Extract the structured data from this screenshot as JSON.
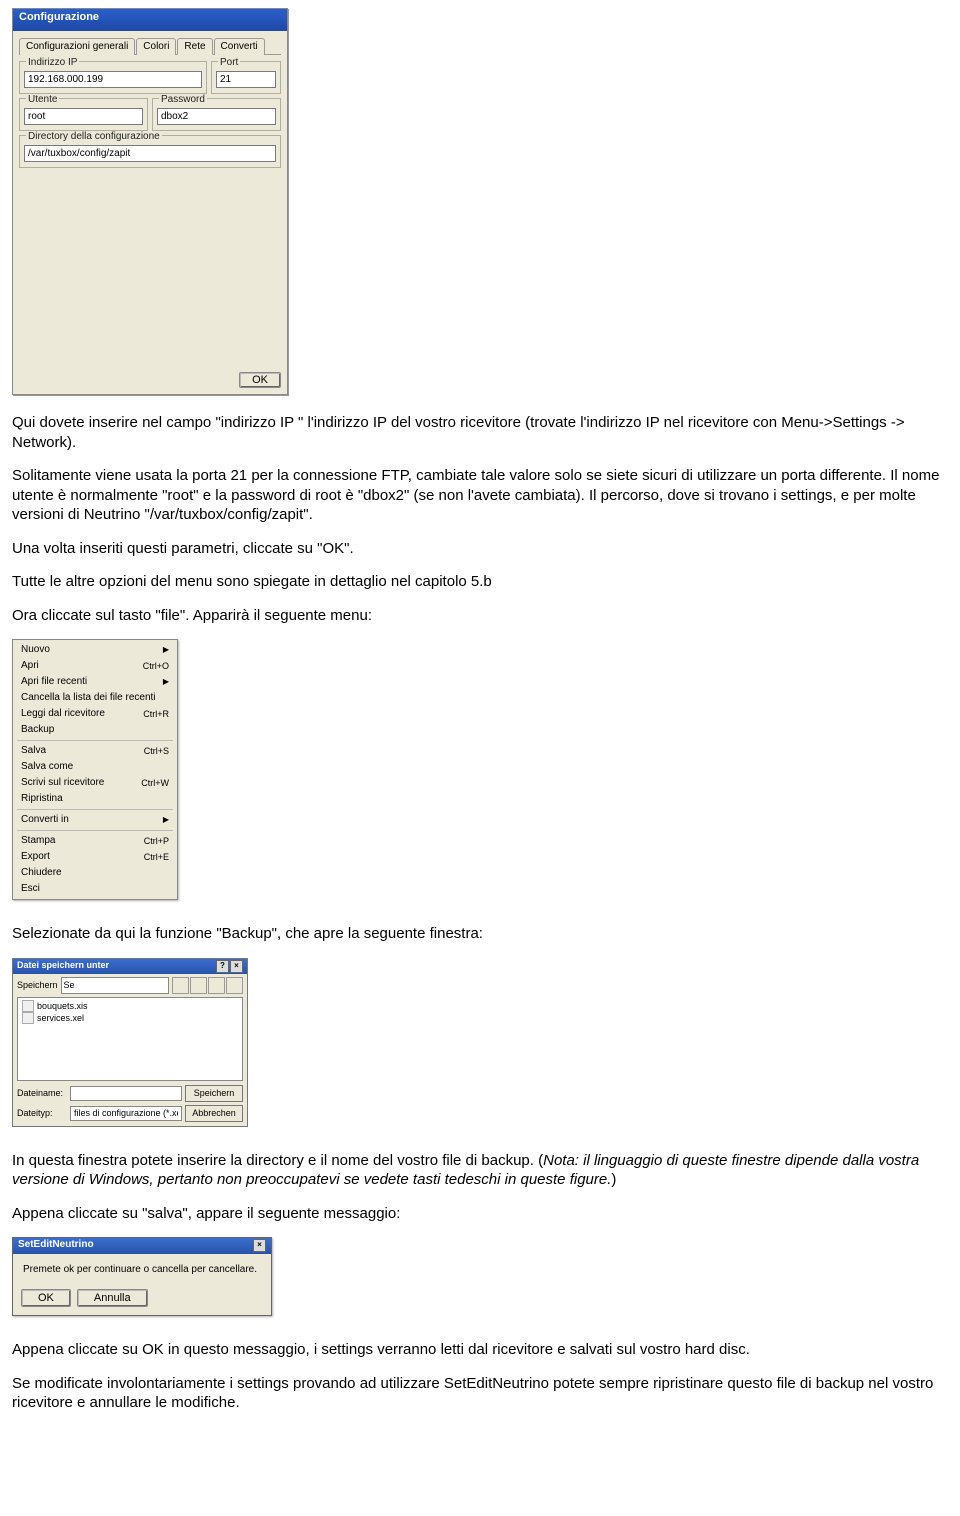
{
  "config_dialog": {
    "title": "Configurazione",
    "tabs": [
      "Configurazioni generali",
      "Colori",
      "Rete",
      "Converti"
    ],
    "active_tab_index": 2,
    "ip_label": "Indirizzo IP",
    "ip_value": "192.168.000.199",
    "port_label": "Port",
    "port_value": "21",
    "user_label": "Utente",
    "user_value": "root",
    "pass_label": "Password",
    "pass_value": "dbox2",
    "dir_label": "Directory della configurazione",
    "dir_value": "/var/tuxbox/config/zapit",
    "ok": "OK"
  },
  "para1": "Qui dovete inserire nel campo \"indirizzo IP \" l'indirizzo IP del vostro ricevitore (trovate l'indirizzo IP nel ricevitore con Menu->Settings -> Network).",
  "para2": "Solitamente viene usata la porta 21 per la connessione FTP, cambiate tale valore solo se siete sicuri di utilizzare un porta differente. Il nome utente è normalmente \"root\" e la password di root è \"dbox2\" (se non l'avete cambiata). Il percorso, dove si trovano i settings, e per molte versioni di Neutrino \"/var/tuxbox/config/zapit\".",
  "para3": "Una volta inseriti questi parametri, cliccate su \"OK\".",
  "para4": "Tutte le altre opzioni del menu sono spiegate in dettaglio nel capitolo 5.b",
  "para5": "Ora cliccate sul tasto \"file\". Apparirà il seguente menu:",
  "file_menu": {
    "groups": [
      [
        {
          "label": "Nuovo",
          "sc": "",
          "arrow": true
        },
        {
          "label": "Apri",
          "sc": "Ctrl+O",
          "arrow": false
        },
        {
          "label": "Apri file recenti",
          "sc": "",
          "arrow": true
        },
        {
          "label": "Cancella la lista dei file recenti",
          "sc": "",
          "arrow": false
        },
        {
          "label": "Leggi dal ricevitore",
          "sc": "Ctrl+R",
          "arrow": false
        },
        {
          "label": "Backup",
          "sc": "",
          "arrow": false
        }
      ],
      [
        {
          "label": "Salva",
          "sc": "Ctrl+S",
          "arrow": false
        },
        {
          "label": "Salva come",
          "sc": "",
          "arrow": false
        },
        {
          "label": "Scrivi sul ricevitore",
          "sc": "Ctrl+W",
          "arrow": false
        },
        {
          "label": "Ripristina",
          "sc": "",
          "arrow": false
        }
      ],
      [
        {
          "label": "Converti in",
          "sc": "",
          "arrow": true
        }
      ],
      [
        {
          "label": "Stampa",
          "sc": "Ctrl+P",
          "arrow": false
        },
        {
          "label": "Export",
          "sc": "Ctrl+E",
          "arrow": false
        },
        {
          "label": "Chiudere",
          "sc": "",
          "arrow": false
        },
        {
          "label": "Esci",
          "sc": "",
          "arrow": false
        }
      ]
    ]
  },
  "para6": "Selezionate da qui la funzione \"Backup\", che apre la seguente finestra:",
  "save_dialog": {
    "title": "Datei speichern unter",
    "lookin_label": "Speichern",
    "lookin_value": "Se",
    "files": [
      "bouquets.xis",
      "services.xel"
    ],
    "filename_label": "Dateiname:",
    "filename_value": "",
    "type_label": "Dateityp:",
    "type_value": "files di configurazione (*.xel)",
    "save_btn": "Speichern",
    "cancel_btn": "Abbrechen"
  },
  "para7a": "In questa finestra potete inserire la directory e il nome del vostro file di backup. (",
  "para7b_italic": "Nota: il linguaggio di queste finestre dipende dalla vostra versione di Windows, pertanto non preoccupatevi se vedete tasti tedeschi in queste figure.",
  "para7c": ")",
  "para8": "Appena cliccate su \"salva\", appare il seguente messaggio:",
  "msgbox": {
    "title": "SetEditNeutrino",
    "text": "Premete ok per continuare o cancella per cancellare.",
    "ok": "OK",
    "cancel": "Annulla"
  },
  "para9": "Appena cliccate su OK in questo messaggio, i settings verranno letti dal ricevitore e salvati sul vostro hard disc.",
  "para10": "Se modificate involontariamente i settings provando ad utilizzare SetEditNeutrino potete sempre ripristinare questo file di backup nel vostro ricevitore e annullare le modifiche."
}
